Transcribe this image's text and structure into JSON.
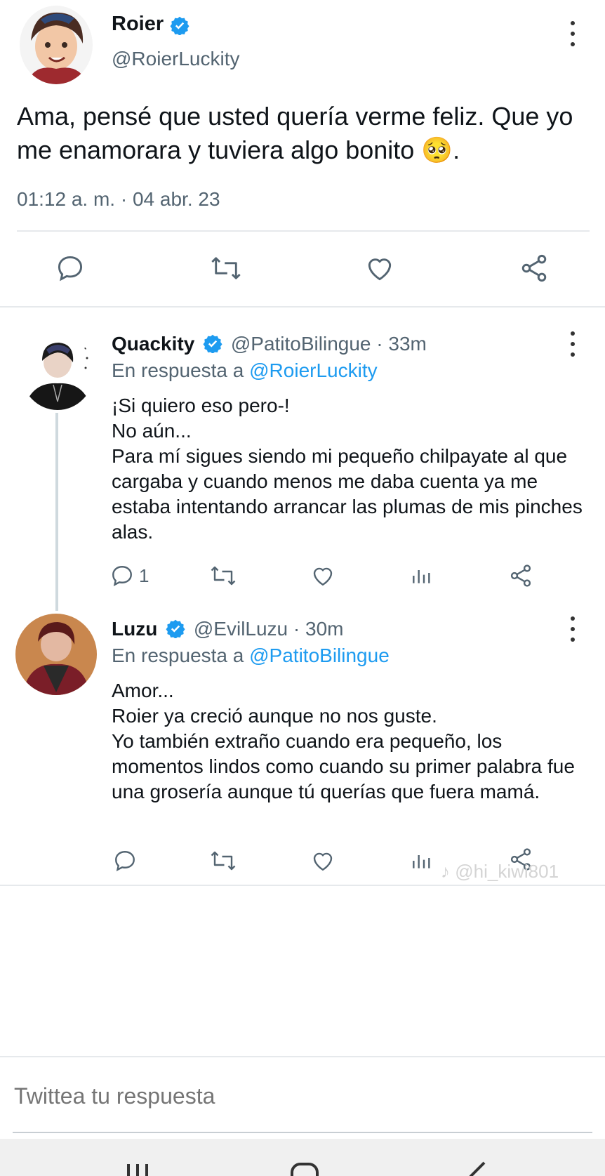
{
  "main_tweet": {
    "name": "Roier",
    "handle": "@RoierLuckity",
    "text": "Ama, pensé que usted quería verme feliz. Que yo me enamorara y tuviera algo bonito 🥺.",
    "timestamp": "01:12 a. m. · 04 abr. 23"
  },
  "replies": [
    {
      "name": "Quackity",
      "handle": "@PatitoBilingue · 33m",
      "reply_prefix": "En respuesta a",
      "reply_to": "@RoierLuckity",
      "text": "¡Si quiero eso pero-!\nNo aún...\nPara mí sigues siendo mi pequeño chilpayate al que cargaba y cuando menos me daba cuenta ya me estaba intentando arrancar las plumas de mis pinches alas.",
      "reply_count": "1"
    },
    {
      "name": "Luzu",
      "handle": "@EvilLuzu · 30m",
      "reply_prefix": "En respuesta a",
      "reply_to": "@PatitoBilingue",
      "text": "Amor...\nRoier ya creció aunque no nos guste.\nYo también extraño cuando era pequeño, los momentos lindos como cuando su primer palabra fue una grosería aunque tú querías que fuera mamá.",
      "reply_count": ""
    }
  ],
  "watermark": "♪ @hi_kiwi801",
  "composer": {
    "placeholder": "Twittea tu respuesta"
  },
  "colors": {
    "link": "#1d9bf0",
    "verified": "#1d9bf0",
    "muted": "#536471",
    "divider": "#e6e9ec",
    "navbar": "#f0f0f0"
  },
  "icons": [
    "reply-icon",
    "retweet-icon",
    "like-icon",
    "share-icon",
    "views-icon",
    "more-icon",
    "verified-badge-icon"
  ]
}
